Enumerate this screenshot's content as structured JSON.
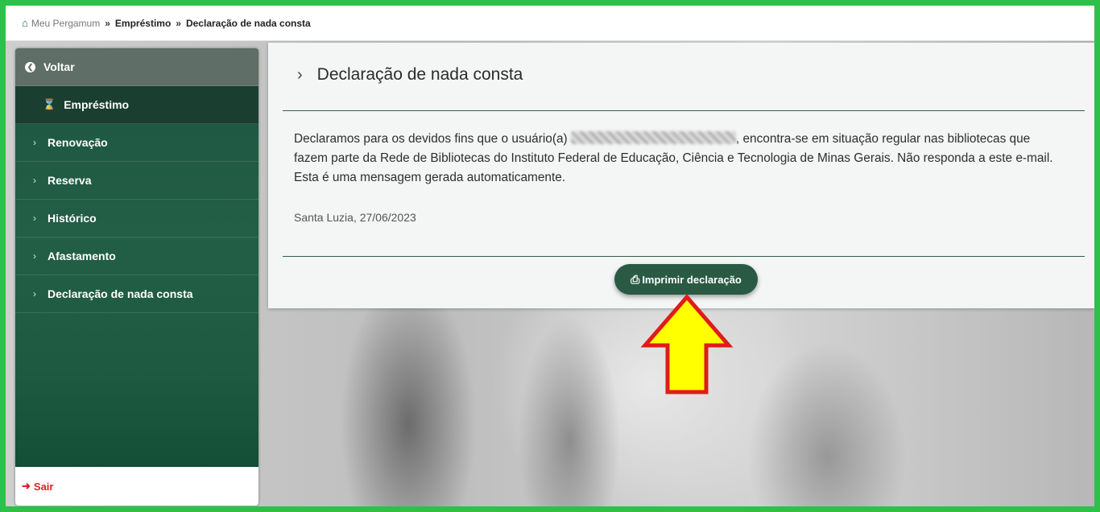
{
  "breadcrumb": {
    "home": "Meu Pergamum",
    "separator": "»",
    "level1": "Empréstimo",
    "level2": "Declaração de nada consta"
  },
  "sidebar": {
    "voltar": "Voltar",
    "active": "Empréstimo",
    "items": [
      {
        "label": "Renovação"
      },
      {
        "label": "Reserva"
      },
      {
        "label": "Histórico"
      },
      {
        "label": "Afastamento"
      },
      {
        "label": "Declaração de nada consta"
      }
    ],
    "sair": "Sair"
  },
  "main": {
    "title": "Declaração de nada consta",
    "text_before": "Declaramos para os devidos fins que o usuário(a) ",
    "text_after": ", encontra-se em situação regular nas bibliotecas que fazem parte da Rede de Bibliotecas do Instituto Federal de Educação, Ciência e Tecnologia de Minas Gerais. Não responda a este e-mail. Esta é uma mensagem gerada automaticamente.",
    "date": "Santa Luzia, 27/06/2023",
    "print_button": "Imprimir declaração"
  },
  "colors": {
    "outer_border": "#2dc14a",
    "sidebar_green": "#235e47",
    "button_green": "#2a5a44",
    "arrow_fill": "#ffff00",
    "arrow_stroke": "#e01b1b"
  }
}
